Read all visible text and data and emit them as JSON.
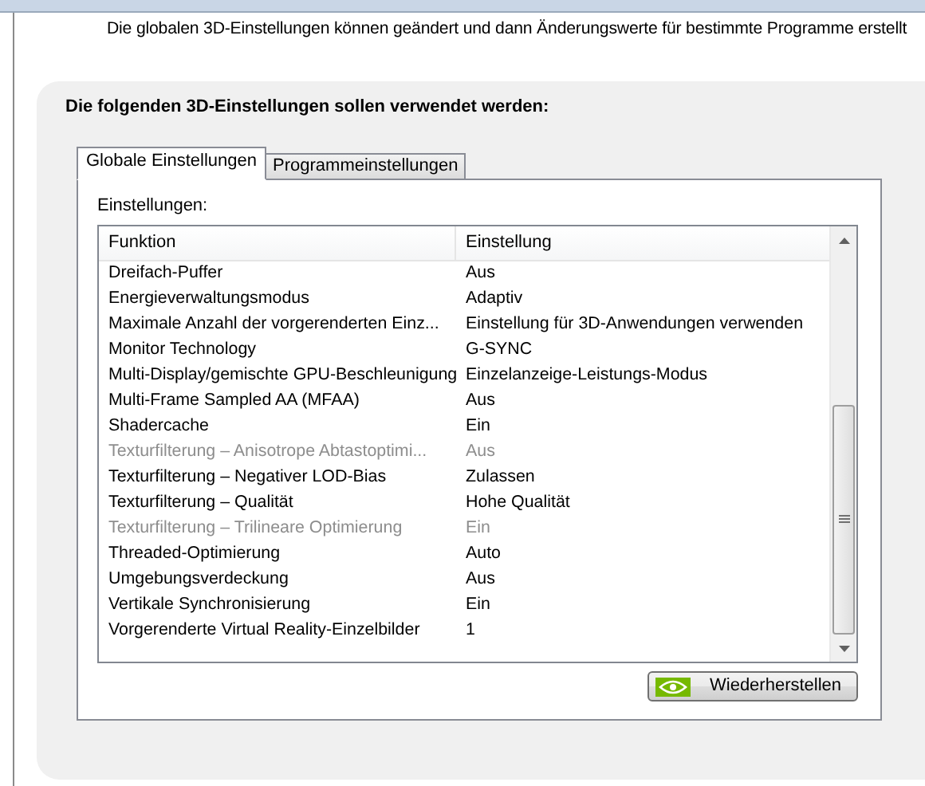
{
  "description": "Die globalen 3D-Einstellungen können geändert und dann Änderungswerte für bestimmte Programme erstellt",
  "panel": {
    "heading": "Die folgenden 3D-Einstellungen sollen verwendet werden:",
    "tabs": [
      {
        "label": "Globale Einstellungen",
        "selected": true
      },
      {
        "label": "Programmeinstellungen",
        "selected": false
      }
    ],
    "settings_label": "Einstellungen:",
    "table": {
      "columns": [
        "Funktion",
        "Einstellung"
      ],
      "rows": [
        {
          "function": "Dreifach-Puffer",
          "setting": "Aus",
          "disabled": false
        },
        {
          "function": "Energieverwaltungsmodus",
          "setting": "Adaptiv",
          "disabled": false
        },
        {
          "function": "Maximale Anzahl der vorgerenderten Einz...",
          "setting": "Einstellung für 3D-Anwendungen verwenden",
          "disabled": false
        },
        {
          "function": "Monitor Technology",
          "setting": "G-SYNC",
          "disabled": false
        },
        {
          "function": "Multi-Display/gemischte GPU-Beschleunigung",
          "setting": "Einzelanzeige-Leistungs-Modus",
          "disabled": false
        },
        {
          "function": "Multi-Frame Sampled AA (MFAA)",
          "setting": "Aus",
          "disabled": false
        },
        {
          "function": "Shadercache",
          "setting": "Ein",
          "disabled": false
        },
        {
          "function": "Texturfilterung – Anisotrope Abtastoptimi...",
          "setting": "Aus",
          "disabled": true
        },
        {
          "function": "Texturfilterung – Negativer LOD-Bias",
          "setting": "Zulassen",
          "disabled": false
        },
        {
          "function": "Texturfilterung – Qualität",
          "setting": "Hohe Qualität",
          "disabled": false
        },
        {
          "function": "Texturfilterung – Trilineare Optimierung",
          "setting": "Ein",
          "disabled": true
        },
        {
          "function": "Threaded-Optimierung",
          "setting": "Auto",
          "disabled": false
        },
        {
          "function": "Umgebungsverdeckung",
          "setting": "Aus",
          "disabled": false
        },
        {
          "function": "Vertikale Synchronisierung",
          "setting": "Ein",
          "disabled": false
        },
        {
          "function": "Vorgerenderte Virtual Reality-Einzelbilder",
          "setting": "1",
          "disabled": false
        }
      ]
    },
    "restore_button": "Wiederherstellen"
  }
}
